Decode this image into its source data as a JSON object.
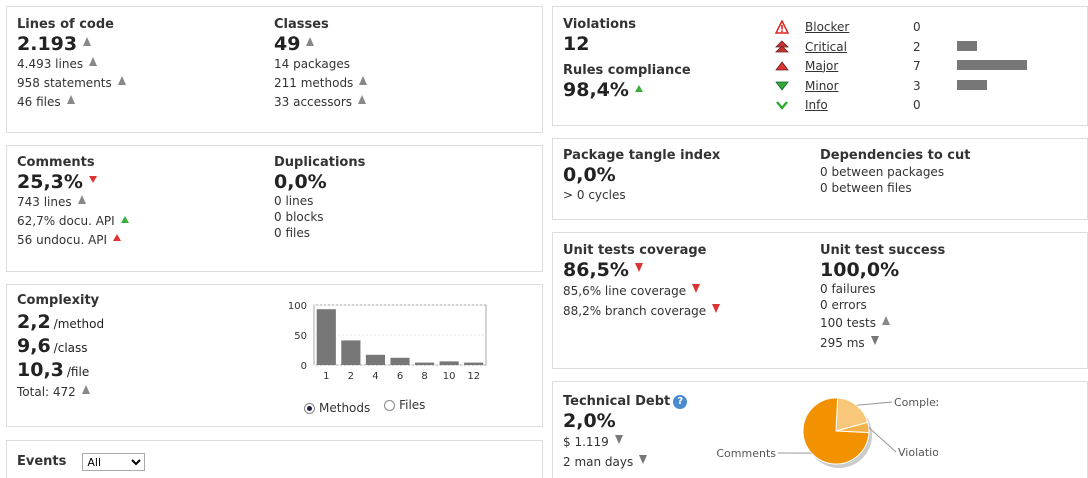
{
  "size": {
    "lines_of_code_title": "Lines of code",
    "lines_of_code_value": "2.193",
    "lines": "4.493 lines",
    "statements": "958 statements",
    "files": "46 files",
    "classes_title": "Classes",
    "classes_value": "49",
    "packages": "14 packages",
    "methods": "211 methods",
    "accessors": "33 accessors"
  },
  "comments": {
    "title": "Comments",
    "value": "25,3%",
    "lines": "743 lines",
    "docu_api": "62,7% docu. API",
    "undocu_api": "56 undocu. API",
    "dup_title": "Duplications",
    "dup_value": "0,0%",
    "dup_lines": "0 lines",
    "dup_blocks": "0 blocks",
    "dup_files": "0 files"
  },
  "complexity": {
    "title": "Complexity",
    "per_method": "2,2",
    "per_method_unit": "/method",
    "per_class": "9,6",
    "per_class_unit": "/class",
    "per_file": "10,3",
    "per_file_unit": "/file",
    "total": "Total: 472",
    "radio_methods": "Methods",
    "radio_files": "Files"
  },
  "chart_data": {
    "type": "bar",
    "categories": [
      "1",
      "2",
      "4",
      "6",
      "8",
      "10",
      "12"
    ],
    "values": [
      93,
      41,
      17,
      12,
      4,
      6,
      4
    ],
    "ylim": [
      0,
      100
    ],
    "yticks": [
      "100",
      "50",
      "0"
    ],
    "grid": true,
    "color": "#777777"
  },
  "events": {
    "title": "Events",
    "select_value": "All"
  },
  "violations": {
    "title": "Violations",
    "value": "12",
    "compliance_title": "Rules compliance",
    "compliance_value": "98,4%",
    "severities": [
      {
        "label": "Blocker",
        "count": "0",
        "fraction": 0,
        "icon": "blocker-icon"
      },
      {
        "label": "Critical",
        "count": "2",
        "fraction": 0.2857,
        "icon": "critical-icon"
      },
      {
        "label": "Major",
        "count": "7",
        "fraction": 1.0,
        "icon": "major-icon"
      },
      {
        "label": "Minor",
        "count": "3",
        "fraction": 0.4286,
        "icon": "minor-icon"
      },
      {
        "label": "Info",
        "count": "0",
        "fraction": 0,
        "icon": "info-icon"
      }
    ]
  },
  "design": {
    "tangle_title": "Package tangle index",
    "tangle_value": "0,0%",
    "cycles": "> 0 cycles",
    "deps_title": "Dependencies to cut",
    "between_packages": "0 between packages",
    "between_files": "0 between files"
  },
  "tests": {
    "coverage_title": "Unit tests coverage",
    "coverage_value": "86,5%",
    "line_coverage": "85,6% line coverage",
    "branch_coverage": "88,2% branch coverage",
    "success_title": "Unit test success",
    "success_value": "100,0%",
    "failures": "0 failures",
    "errors": "0 errors",
    "tests": "100 tests",
    "duration": "295 ms"
  },
  "debt": {
    "title": "Technical Debt",
    "value": "2,0%",
    "cost": "$ 1.119",
    "days": "2 man days",
    "pie": [
      {
        "label": "Complexity",
        "share": 0.2,
        "color": "#f9c77a"
      },
      {
        "label": "Violations",
        "share": 0.05,
        "color": "#f5b24a"
      },
      {
        "label": "Comments",
        "share": 0.75,
        "color": "#f39200"
      }
    ]
  }
}
